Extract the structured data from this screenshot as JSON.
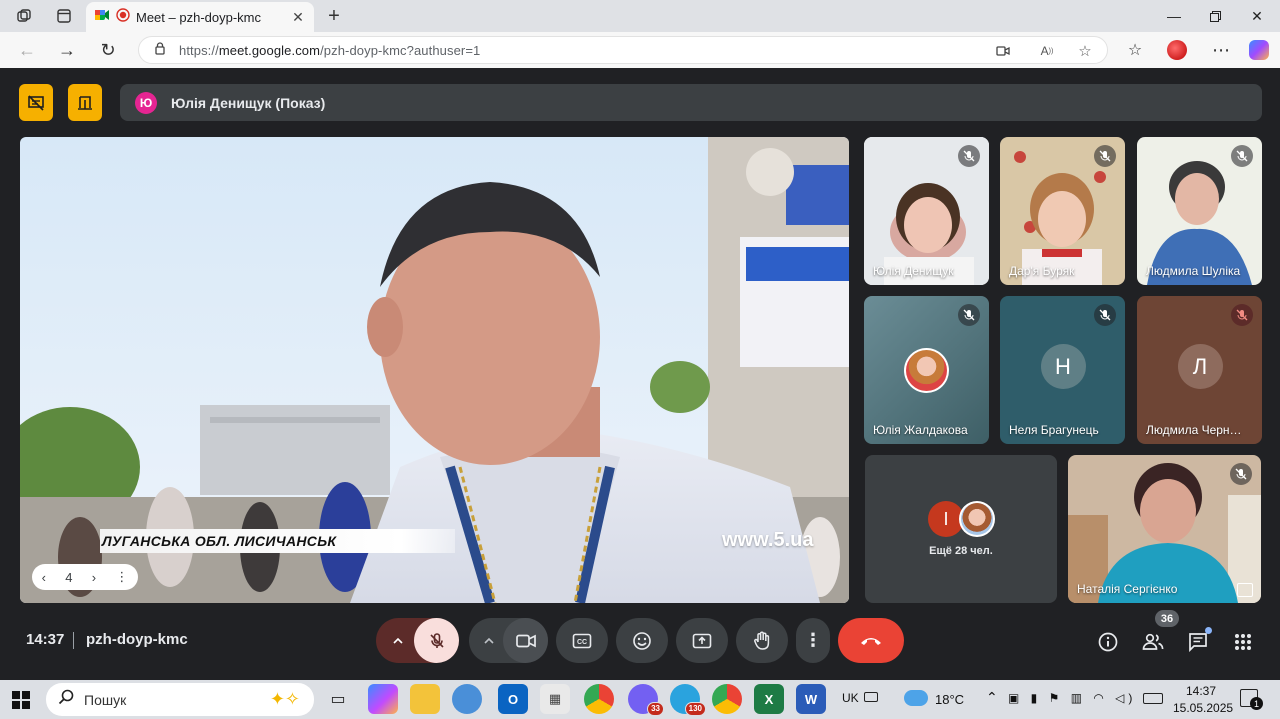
{
  "browser": {
    "tab_title": "Meet – pzh-doyp-kmc",
    "url_prefix": "https://",
    "url_domain": "meet.google.com",
    "url_path": "/pzh-doyp-kmc?authuser=1"
  },
  "meet": {
    "presenter_initial": "Ю",
    "presenter_label": "Юлія Денищук (Показ)",
    "video_caption": "ЛУГАНСЬКА ОБЛ. ЛИСИЧАНСЬК",
    "video_site": "www.5.ua",
    "pager_value": "4",
    "participants": [
      {
        "name": "Юлія Денищук",
        "initial": ""
      },
      {
        "name": "Дар'я Буряк",
        "initial": ""
      },
      {
        "name": "Людмила Шуліка",
        "initial": ""
      },
      {
        "name": "Юлія Жалдакова",
        "initial": ""
      },
      {
        "name": "Неля Брагунець",
        "initial": "Н"
      },
      {
        "name": "Людмила Черн…",
        "initial": "Л"
      },
      {
        "name": "Наталія Сергієнко",
        "initial": ""
      }
    ],
    "others_initial": "І",
    "others_label": "Ещё 28 чел.",
    "clock": "14:37",
    "meeting_code": "pzh-doyp-kmc",
    "people_count": "36"
  },
  "taskbar": {
    "search_placeholder": "Пошук",
    "viber_badge": "33",
    "telegram_badge": "130",
    "lang": "UK",
    "weather_temp": "18°C",
    "time": "14:37",
    "date": "15.05.2025",
    "notif_count": "1"
  },
  "colors": {
    "meet_bg": "#202124",
    "control_bg": "#3c4043",
    "end_call_red": "#ea4335",
    "highlight_yellow": "#f6b000"
  }
}
